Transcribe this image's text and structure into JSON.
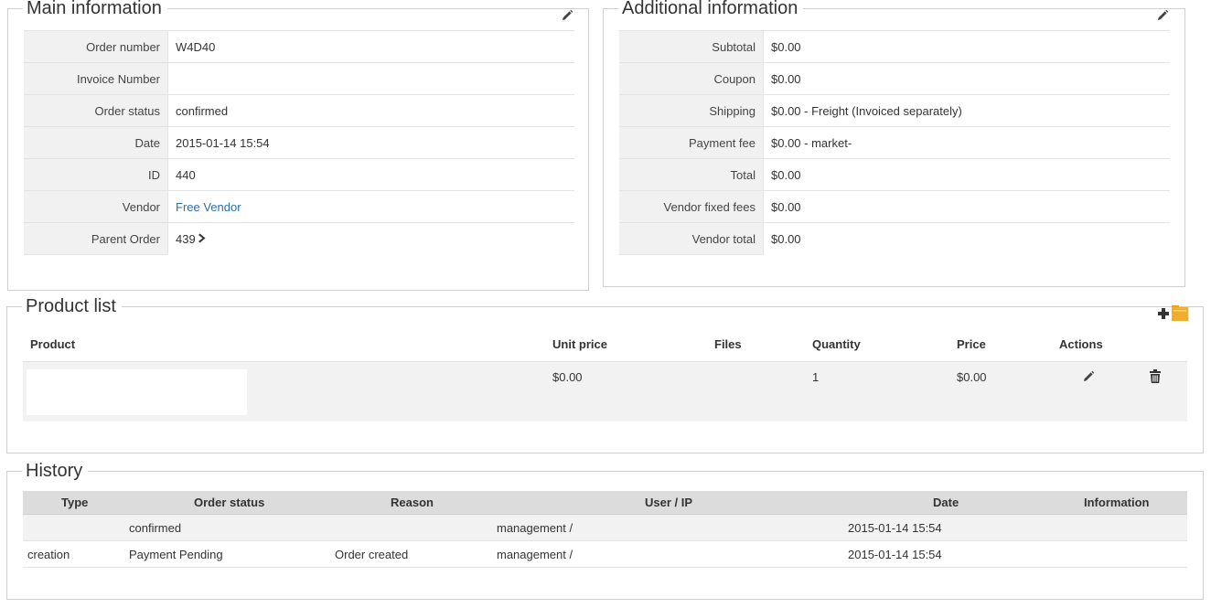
{
  "main_info": {
    "title": "Main information",
    "rows": [
      {
        "label": "Order number",
        "value": "W4D40"
      },
      {
        "label": "Invoice Number",
        "value": ""
      },
      {
        "label": "Order status",
        "value": "confirmed"
      },
      {
        "label": "Date",
        "value": "2015-01-14 15:54"
      },
      {
        "label": "ID",
        "value": "440"
      },
      {
        "label": "Vendor",
        "value": "Free Vendor"
      },
      {
        "label": "Parent Order",
        "value": "439"
      }
    ]
  },
  "additional_info": {
    "title": "Additional information",
    "rows": [
      {
        "label": "Subtotal",
        "value": "$0.00"
      },
      {
        "label": "Coupon",
        "value": "$0.00"
      },
      {
        "label": "Shipping",
        "value": "$0.00 - Freight (Invoiced separately)"
      },
      {
        "label": "Payment fee",
        "value": "$0.00 - market-"
      },
      {
        "label": "Total",
        "value": "$0.00"
      },
      {
        "label": "Vendor fixed fees",
        "value": "$0.00"
      },
      {
        "label": "Vendor total",
        "value": "$0.00"
      }
    ]
  },
  "product_list": {
    "title": "Product list",
    "headers": {
      "product": "Product",
      "unit_price": "Unit price",
      "files": "Files",
      "quantity": "Quantity",
      "price": "Price",
      "actions": "Actions"
    },
    "rows": [
      {
        "product": "",
        "unit_price": "$0.00",
        "files": "",
        "quantity": "1",
        "price": "$0.00"
      }
    ]
  },
  "history": {
    "title": "History",
    "headers": {
      "type": "Type",
      "order_status": "Order status",
      "reason": "Reason",
      "user_ip": "User / IP",
      "date": "Date",
      "information": "Information"
    },
    "rows": [
      {
        "type": "",
        "order_status": "confirmed",
        "reason": "",
        "user_ip": "management /",
        "date": "2015-01-14 15:54",
        "information": ""
      },
      {
        "type": "creation",
        "order_status": "Payment Pending",
        "reason": "Order created",
        "user_ip": "management /",
        "date": "2015-01-14 15:54",
        "information": ""
      }
    ]
  },
  "icons": {
    "edit": "pencil-icon",
    "parent_link": "chevron-right-icon",
    "add_product": "plus-icon",
    "add_from_list": "folder-icon",
    "delete": "trash-icon"
  },
  "colors": {
    "link": "#2a6fb0",
    "label_bg": "#f1f1f1",
    "header_bg": "#dcdcdc",
    "folder": "#f0ad2e"
  }
}
